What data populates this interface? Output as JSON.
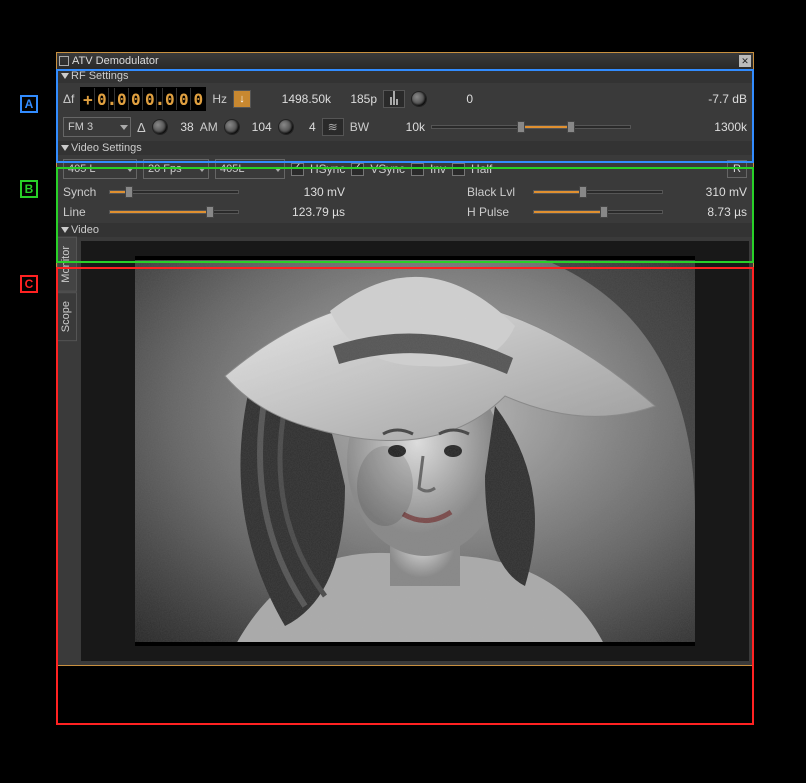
{
  "window": {
    "title": "ATV Demodulator"
  },
  "annotations": {
    "a": "A",
    "b": "B",
    "c": "C"
  },
  "rf": {
    "section_label": "RF Settings",
    "deltaf_label": "Δf",
    "freq_digits": [
      "+",
      "0",
      ".",
      "0",
      "0",
      "0",
      ".",
      "0",
      "0",
      "0"
    ],
    "hz_label": "Hz",
    "rate_label": "1498.50k",
    "pts_label": "185p",
    "num_value": "0",
    "db_value": "-7.7 dB",
    "mod_select": "FM 3",
    "delta_sym": "Δ",
    "delta_val": "38",
    "am_label": "AM",
    "am_val": "104",
    "fm_val": "4",
    "bw_label": "BW",
    "bw_low": "10k",
    "bw_high": "1300k"
  },
  "video": {
    "section_label": "Video Settings",
    "std_select": "405 L",
    "fps_select": "20 Fps",
    "lines_select": "405L",
    "hsync_label": "HSync",
    "vsync_label": "VSync",
    "inv_label": "Inv",
    "half_label": "Half",
    "r_label": "R",
    "synch_label": "Synch",
    "synch_value": "130 mV",
    "black_label": "Black Lvl",
    "black_value": "310 mV",
    "line_label": "Line",
    "line_value": "123.79 µs",
    "hpulse_label": "H Pulse",
    "hpulse_value": "8.73 µs"
  },
  "vv": {
    "section_label": "Video",
    "tab_monitor": "Monitor",
    "tab_scope": "Scope"
  }
}
